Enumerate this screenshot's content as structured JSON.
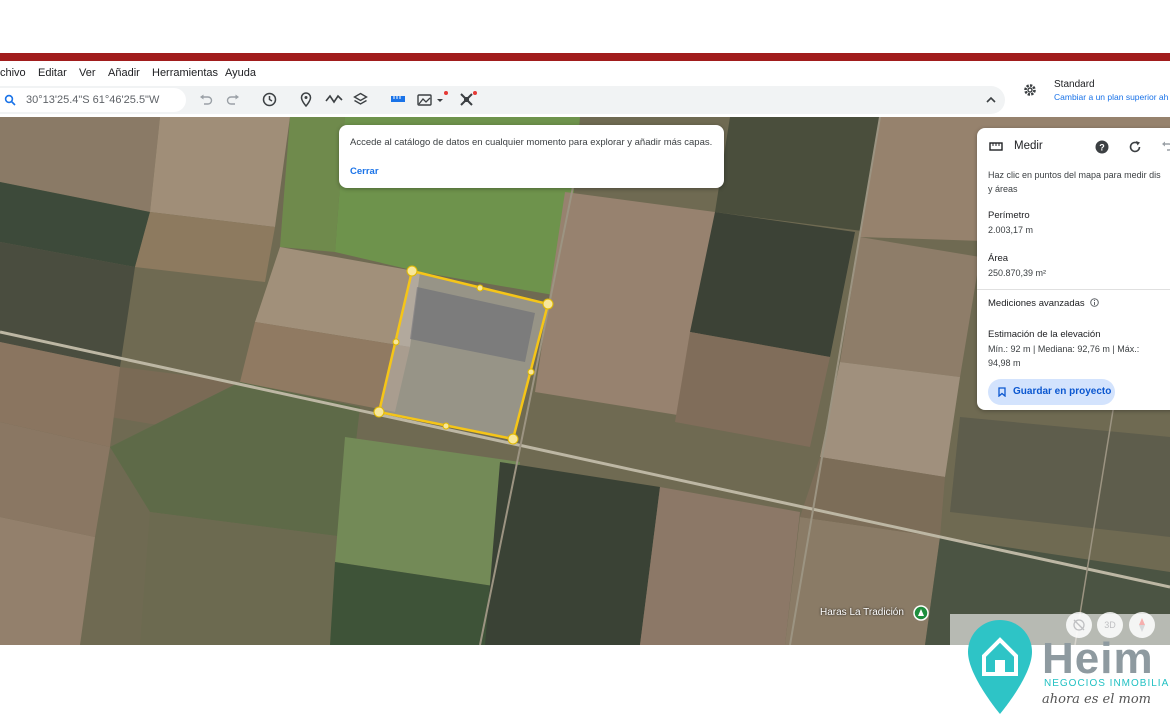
{
  "menu": {
    "archivo": "chivo",
    "editar": "Editar",
    "ver": "Ver",
    "anadir": "Añadir",
    "herramientas": "Herramientas",
    "ayuda": "Ayuda"
  },
  "search": {
    "value": "30°13'25.4\"S 61°46'25.5\"W"
  },
  "icons": [
    "search-icon",
    "undo-icon",
    "redo-icon",
    "history-icon",
    "placemark-icon",
    "path-icon",
    "layers-icon",
    "ruler-icon",
    "image-overlay-icon",
    "satellite-icon",
    "chevron-up-icon",
    "gear-icon",
    "help-icon",
    "refresh-icon",
    "undo-measure-icon",
    "bookmark-icon",
    "pin-icon"
  ],
  "plan": {
    "label": "Standard",
    "upgrade": "Cambiar a un plan superior ah"
  },
  "tip": {
    "message": "Accede al catálogo de datos en cualquier momento para explorar y añadir más capas.",
    "close": "Cerrar"
  },
  "measure": {
    "title": "Medir",
    "instruction_line1": "Haz clic en puntos del mapa para medir dis",
    "instruction_line2": "y áreas",
    "perimeter_label": "Perímetro",
    "perimeter_value": "2.003,17 m",
    "area_label": "Área",
    "area_value": "250.870,39 m²",
    "advanced": "Mediciones avanzadas",
    "elevation_label": "Estimación de la elevación",
    "elevation_line1": "Mín.: 92 m | Mediana: 92,76 m | Máx.:",
    "elevation_line2": "94,98 m",
    "save": "Guardar en proyecto"
  },
  "map": {
    "place": "Haras La Tradición",
    "view_3d": "3D",
    "polygon_color": "#f5c518"
  },
  "brand": {
    "name": "Heim",
    "subtitle": "NEGOCIOS INMOBILIA",
    "slogan": "ahora es el mom"
  },
  "colors": {
    "accent": "#1a73e8",
    "topbar": "#a11d1d"
  }
}
